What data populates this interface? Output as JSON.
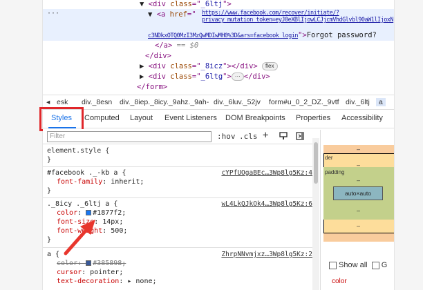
{
  "elements": {
    "line1": {
      "prefix": "▼",
      "open": "<div ",
      "attr": "class",
      "eq": "=\"",
      "val": "_6ltj",
      "close": "\">"
    },
    "line2": {
      "prefix": "▼",
      "open": "<a ",
      "attr": "href",
      "eq": "=\"",
      "val": "https://www.facebook.com/recover/initiate/?privacy_mutation_token=eyJ0eXBlIjowLCJjcmVhdGlvbl90aW1lIjoxNjY",
      "close": ""
    },
    "line3": {
      "val": "c3NDkxOTQ0MzI3MzQwMDIwMH0%3D&ars=facebook_login",
      "close": "\">",
      "text": "Forgot password?"
    },
    "line4": {
      "close_tag": "</a>",
      "marker": "== $0"
    },
    "line5": {
      "close_tag": "</div>"
    },
    "line6": {
      "prefix": "▶",
      "open": "<div ",
      "attr": "class",
      "eq": "=\"",
      "val": "_8icz",
      "close": "\"></div>",
      "pill": "flex"
    },
    "line7": {
      "prefix": "▶",
      "open": "<div ",
      "attr": "class",
      "eq": "=\"",
      "val": "_6ltg",
      "close": "\">",
      "pill": "···",
      "close2": "</div>"
    },
    "line8": {
      "close_tag": "</form>"
    },
    "gutter_dots": "···"
  },
  "breadcrumb": {
    "items": [
      "◂",
      "esk",
      "div._8esn",
      "div._8iep._8icy._9ahz._9ah-",
      "div._6luv._52jv",
      "form#u_0_2_DZ._9vtf",
      "div._6ltj",
      "a"
    ]
  },
  "tabs": {
    "items": [
      "Styles",
      "Computed",
      "Layout",
      "Event Listeners",
      "DOM Breakpoints",
      "Properties",
      "Accessibility"
    ],
    "active": "Styles"
  },
  "filter": {
    "placeholder": "Filter",
    "hov": ":hov",
    "cls": ".cls",
    "plus": "+"
  },
  "styles": {
    "rule1": {
      "selector": "element.style {",
      "close": "}"
    },
    "rule2": {
      "selector": "#facebook ._-kb a {",
      "source": "cYPfUOgaBEc…3Wp8lg5Kz:4",
      "prop": "font-family",
      "value": "inherit;",
      "close": "}"
    },
    "rule3": {
      "selector": "._8icy ._6ltj a {",
      "source": "wL4LkQJkOk4…3Wp8lg5Kz:6",
      "p1": "color",
      "v1": "#1877f2;",
      "swatch1": "#1877f2",
      "p2": "font-size",
      "v2": "14px;",
      "p3": "font-weight",
      "v3": "500;",
      "close": "}"
    },
    "rule4": {
      "selector": "a {",
      "source": "ZhrpNNvmjxz…3Wp8lg5Kz:2",
      "p1": "color",
      "v1": "#385898;",
      "swatch1": "#385898",
      "p2": "cursor",
      "v2": "pointer;",
      "p3": "text-decoration",
      "v3": "▸ none;"
    }
  },
  "boxmodel": {
    "margin_top": "–",
    "border_label": "der",
    "border_value": "–",
    "padding_label": "padding",
    "padding_value": "–",
    "content": "auto×auto",
    "bottom1": "–",
    "bottom2": "–"
  },
  "computed": {
    "show_all": "Show all",
    "group_initial": "G",
    "first_prop": "color"
  },
  "colors": {
    "accent": "#1a73e8",
    "highlight": "#e0262a",
    "arrow": "#e8362d"
  },
  "icons": [
    "new-style-rule-icon",
    "toggle-element-state-icon",
    "computed-sidebar-icon"
  ]
}
